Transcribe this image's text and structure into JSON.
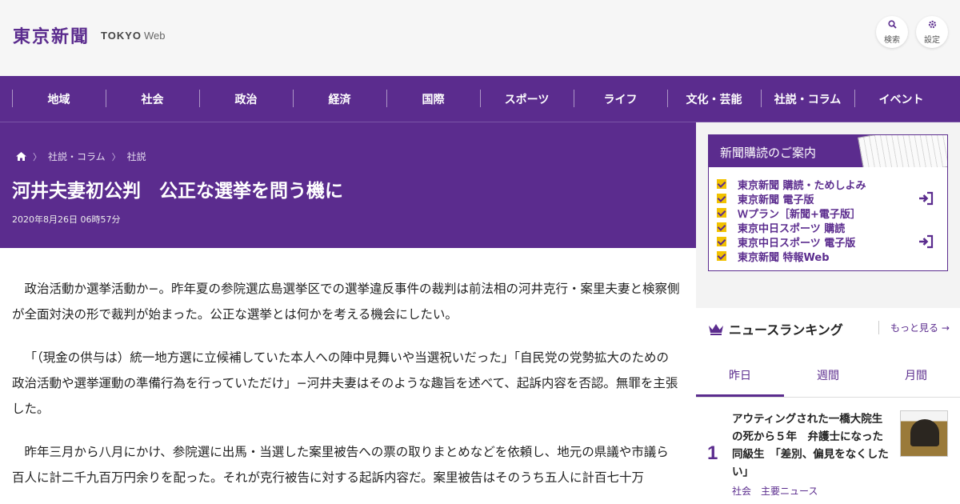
{
  "header": {
    "logo_jp": "東京新聞",
    "logo_en_bold": "TOKYO",
    "logo_en_web": "Web",
    "search_label": "検索",
    "settings_label": "設定"
  },
  "nav": {
    "items": [
      "地域",
      "社会",
      "政治",
      "経済",
      "国際",
      "スポーツ",
      "ライフ",
      "文化・芸能",
      "社説・コラム",
      "イベント"
    ]
  },
  "breadcrumb": {
    "items": [
      "社説・コラム",
      "社説"
    ]
  },
  "article": {
    "title": "河井夫妻初公判　公正な選挙を問う機に",
    "date": "2020年8月26日 06時57分",
    "paragraphs": [
      "政治活動か選挙活動か−。昨年夏の参院選広島選挙区での選挙違反事件の裁判は前法相の河井克行・案里夫妻と検察側が全面対決の形で裁判が始まった。公正な選挙とは何かを考える機会にしたい。",
      "「（現金の供与は）統一地方選に立候補していた本人への陣中見舞いや当選祝いだった」「自民党の党勢拡大のための政治活動や選挙運動の準備行為を行っていただけ」−河井夫妻はそのような趣旨を述べて、起訴内容を否認。無罪を主張した。",
      "昨年三月から八月にかけ、参院選に出馬・当選した案里被告への票の取りまとめなどを依頼し、地元の県議や市議ら百人に計二千九百万円余りを配った。それが克行被告に対する起訴内容だ。案里被告はそのうち五人に計百七十万"
    ]
  },
  "subscription": {
    "title": "新聞購読のご案内",
    "items": [
      "東京新聞 購読・ためしよみ",
      "東京新聞 電子版",
      "Ｗプラン［新聞+電子版］",
      "東京中日スポーツ 購読",
      "東京中日スポーツ 電子版",
      "東京新聞 特報Web"
    ]
  },
  "ranking": {
    "title": "ニュースランキング",
    "more": "もっと見る",
    "tabs": [
      "昨日",
      "週間",
      "月間"
    ],
    "items": [
      {
        "rank": "1",
        "title": "アウティングされた一橋大院生の死から５年　弁護士になった同級生　「差別、偏見をなくしたい」",
        "category": "社会",
        "tag": "主要ニュース"
      }
    ]
  },
  "colors": {
    "brand": "#5b2c8e",
    "check": "#f2c200"
  }
}
